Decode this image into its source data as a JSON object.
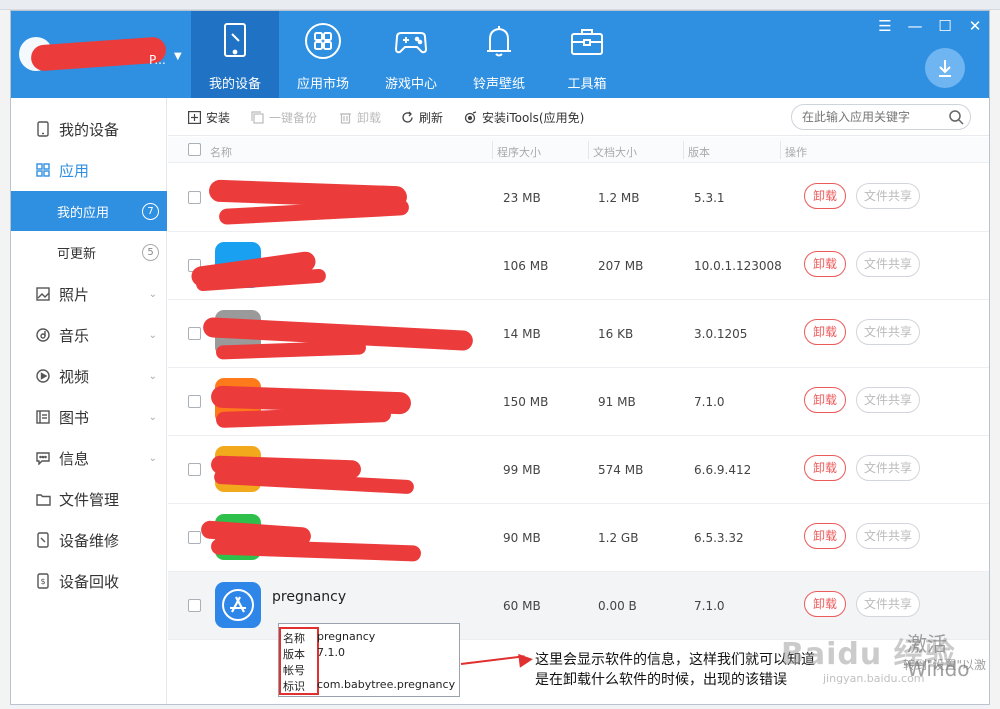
{
  "header": {
    "user_name": "P...",
    "nav": [
      {
        "label": "我的设备",
        "icon": "tablet-icon",
        "active": true
      },
      {
        "label": "应用市场",
        "icon": "apps-grid-icon",
        "active": false
      },
      {
        "label": "游戏中心",
        "icon": "gamepad-icon",
        "active": false
      },
      {
        "label": "铃声壁纸",
        "icon": "bell-icon",
        "active": false
      },
      {
        "label": "工具箱",
        "icon": "toolbox-icon",
        "active": false
      }
    ],
    "window_controls": [
      "☰",
      "—",
      "☐",
      "✕"
    ],
    "download_icon": "download-icon"
  },
  "sidebar": {
    "items": [
      {
        "label": "我的设备",
        "icon": "device-icon"
      },
      {
        "label": "应用",
        "icon": "app-grid-icon"
      },
      {
        "label": "照片",
        "icon": "photo-icon"
      },
      {
        "label": "音乐",
        "icon": "music-icon"
      },
      {
        "label": "视频",
        "icon": "video-icon"
      },
      {
        "label": "图书",
        "icon": "book-icon"
      },
      {
        "label": "信息",
        "icon": "message-icon"
      },
      {
        "label": "文件管理",
        "icon": "folder-icon"
      },
      {
        "label": "设备维修",
        "icon": "repair-icon"
      },
      {
        "label": "设备回收",
        "icon": "recycle-icon"
      }
    ],
    "subitems": [
      {
        "label": "我的应用",
        "count": "7",
        "active": true
      },
      {
        "label": "可更新",
        "count": "5",
        "active": false
      }
    ]
  },
  "toolbar": {
    "install": "安装",
    "backup": "一键备份",
    "uninstall": "卸载",
    "refresh": "刷新",
    "install_itools": "安装iTools(应用免)",
    "search_placeholder": "在此输入应用关键字"
  },
  "table": {
    "columns": [
      "名称",
      "程序大小",
      "文档大小",
      "版本",
      "操作"
    ],
    "uninstall_label": "卸载",
    "share_label": "文件共享",
    "rows": [
      {
        "name": "",
        "size": "23 MB",
        "doc": "1.2 MB",
        "version": "5.3.1",
        "icon_color": "#ffffff"
      },
      {
        "name": "",
        "size": "106 MB",
        "doc": "207 MB",
        "version": "10.0.1.123008",
        "icon_color": "#1aa0f0"
      },
      {
        "name": "",
        "size": "14 MB",
        "doc": "16 KB",
        "version": "3.0.1205",
        "icon_color": "#9a9a9a"
      },
      {
        "name": "",
        "size": "150 MB",
        "doc": "91 MB",
        "version": "7.1.0",
        "icon_color": "#ff7a1a"
      },
      {
        "name": "",
        "size": "99 MB",
        "doc": "574 MB",
        "version": "6.6.9.412",
        "icon_color": "#f2a91c"
      },
      {
        "name": "",
        "size": "90 MB",
        "doc": "1.2 GB",
        "version": "6.5.3.32",
        "icon_color": "#2ec04a"
      },
      {
        "name": "pregnancy",
        "size": "60 MB",
        "doc": "0.00 B",
        "version": "7.1.0",
        "icon_color": "#2d86e8"
      }
    ]
  },
  "tooltip": {
    "rows": [
      {
        "key": "名称",
        "value": "pregnancy"
      },
      {
        "key": "版本",
        "value": "7.1.0"
      },
      {
        "key": "帐号",
        "value": ""
      },
      {
        "key": "标识",
        "value": "com.babytree.pregnancy"
      }
    ]
  },
  "annotation": {
    "line1": "这里会显示软件的信息，这样我们就可以知道",
    "line2": "是在卸载什么软件的时候，出现的该错误"
  },
  "watermark": {
    "brand": "Baidu 经验",
    "url": "jingyan.baidu.com",
    "windows_activate": "激活 Windo",
    "windows_hint": "转到\"设置\"以激"
  }
}
